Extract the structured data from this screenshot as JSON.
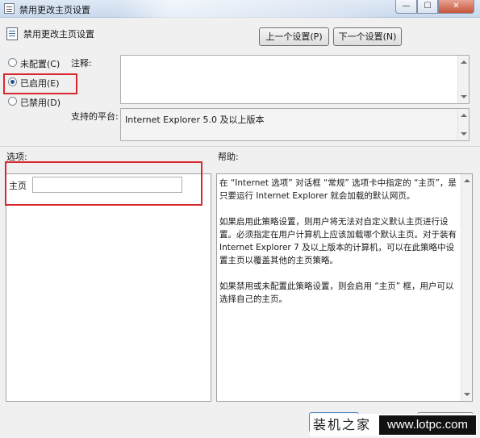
{
  "window": {
    "title": "禁用更改主页设置",
    "controls": {
      "minimize": "—",
      "maximize": "☐",
      "close": "✕"
    }
  },
  "header": {
    "policy_name": "禁用更改主页设置",
    "prev_button": "上一个设置(P)",
    "next_button": "下一个设置(N)"
  },
  "state": {
    "options": [
      {
        "label": "未配置(C)",
        "selected": false
      },
      {
        "label": "已启用(E)",
        "selected": true
      },
      {
        "label": "已禁用(D)",
        "selected": false
      }
    ]
  },
  "comment": {
    "label": "注释:",
    "value": ""
  },
  "platform": {
    "label": "支持的平台:",
    "value": "Internet Explorer 5.0 及以上版本"
  },
  "options_section": {
    "label": "选项:",
    "home_label": "主页",
    "home_value": ""
  },
  "help_section": {
    "label": "帮助:",
    "paragraphs": [
      "在 “Internet 选项” 对话框 “常规” 选项卡中指定的 “主页”，是只要运行 Internet Explorer 就会加载的默认网页。",
      "如果启用此策略设置，则用户将无法对自定义默认主页进行设置。必须指定在用户计算机上应该加载哪个默认主页。对于装有 Internet Explorer 7 及以上版本的计算机，可以在此策略中设置主页以覆盖其他的主页策略。",
      "如果禁用或未配置此策略设置，则会启用 “主页” 框，用户可以选择自己的主页。"
    ]
  },
  "watermark": {
    "left": "装机之家",
    "right": "www.lotpc.com"
  },
  "colors": {
    "highlight_box": "#d8282f",
    "window_bg": "#f0f0f0"
  }
}
